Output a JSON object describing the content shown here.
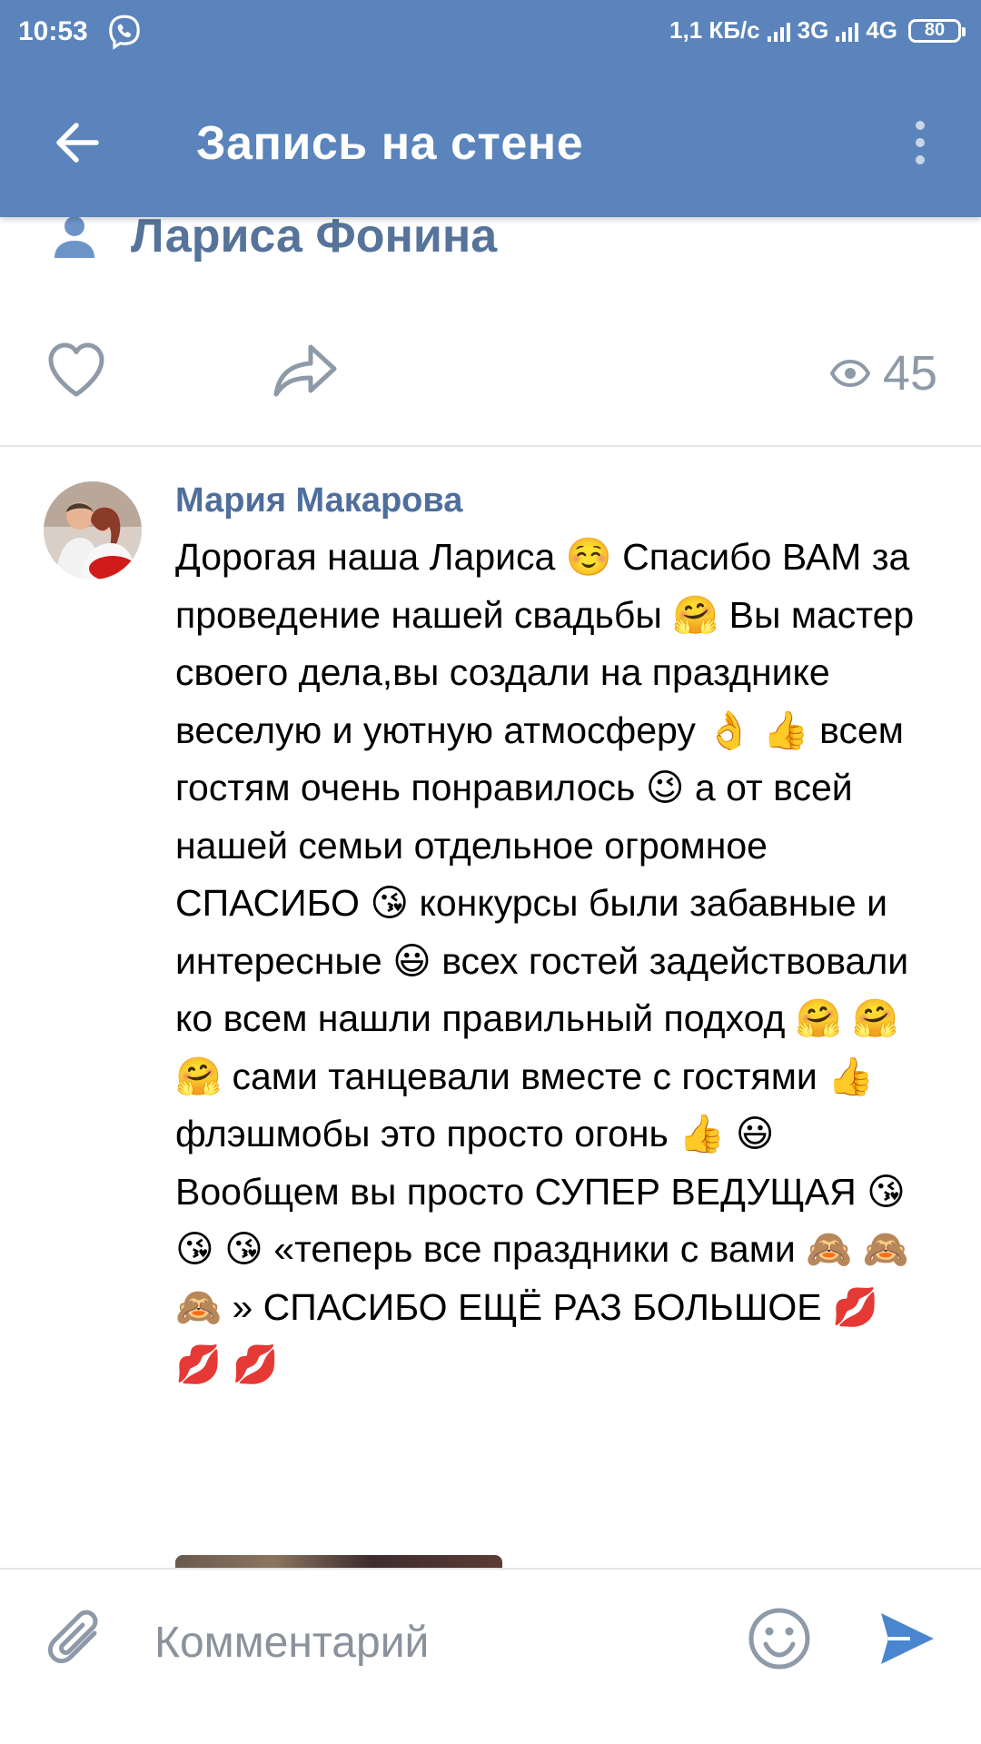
{
  "status_bar": {
    "time": "10:53",
    "net_speed": "1,1 КБ/с",
    "net_1": "3G",
    "net_2": "4G",
    "battery": "80",
    "icons": [
      "viber-icon",
      "signal-icon",
      "signal-icon",
      "battery-icon"
    ]
  },
  "app_bar": {
    "title": "Запись на стене",
    "back_icon": "arrow-left-icon",
    "menu_icon": "more-vert-icon",
    "color": "#5a84bb"
  },
  "post": {
    "owner_name": "Лариса Фонина",
    "views": "45"
  },
  "comment": {
    "author": "Мария Макарова",
    "text": "Дорогая наша Лариса ☺️ Спасибо ВАМ за проведение нашей свадьбы 🤗 Вы мастер своего дела,вы создали на празднике веселую и уютную атмосферу 👌 👍 всем гостям очень понравилось 😉 а от всей нашей семьи отдельное огромное СПАСИБО 😘 конкурсы были забавные и интересные 😃 всех гостей задействовали ко всем нашли правильный подход 🤗 🤗 🤗 сами танцевали вместе с гостями 👍 флэшмобы  это просто огонь 👍 😃 Вообщем вы просто СУПЕР ВЕДУЩАЯ 😘 😘 😘 «теперь все праздники с вами 🙈 🙈 🙈 » СПАСИБО ЕЩЁ РАЗ БОЛЬШОЕ 💋 💋 💋"
  },
  "input": {
    "placeholder": "Комментарий"
  },
  "colors": {
    "accent": "#5a84bb",
    "name_link": "#4e6f9b",
    "icon_gray": "#8e9aa8"
  }
}
